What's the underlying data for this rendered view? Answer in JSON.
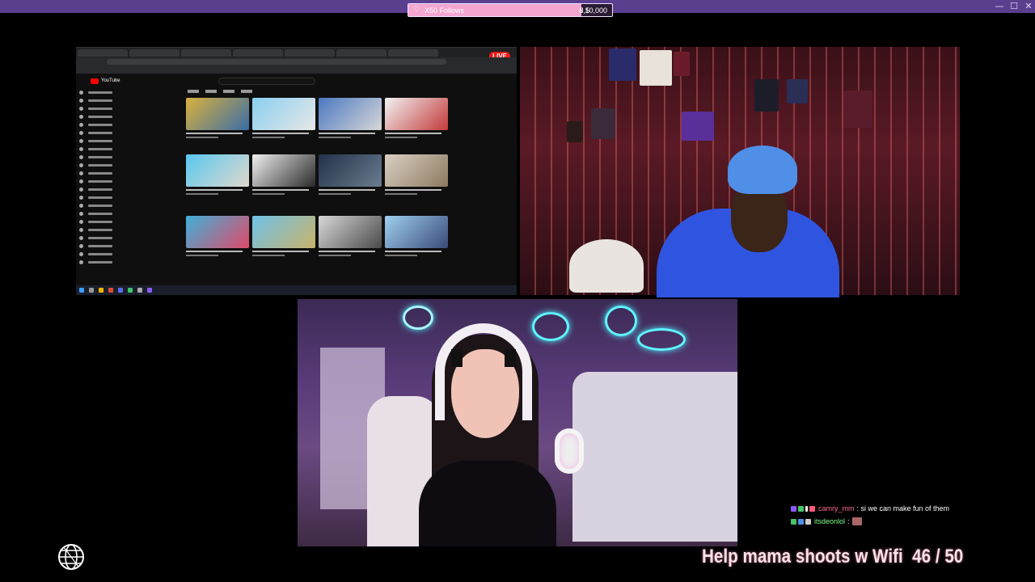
{
  "window": {
    "controls": {
      "minimize": "—",
      "maximize": "☐",
      "close": "✕"
    }
  },
  "follow_goal": {
    "label": "X50 Follows",
    "current": "8,5",
    "target": "/ 10,000",
    "progress_fraction": 0.85,
    "fill_color": "#f4a6d1"
  },
  "screen_share": {
    "live_badge": "LIVE",
    "site": "YouTube",
    "accent": "#ff0000"
  },
  "chat": {
    "messages": [
      {
        "user": "camry_mm",
        "user_color": "#ff6f8a",
        "text": ": si we can make fun of them",
        "badges": [
          "#8a5cff",
          "#46c46a",
          "#ffffff",
          "#ff5c7c"
        ]
      },
      {
        "user": "itsdeonlol",
        "user_color": "#7fff8a",
        "text": " :",
        "badges": [
          "#46c46a",
          "#4f8fe8",
          "#cccccc"
        ],
        "emote": "emote"
      }
    ]
  },
  "stream_goal_text": {
    "title": "Help mama shoots w Wifi",
    "progress": "46 / 50",
    "color": "#ffe1ea"
  },
  "icons": {
    "globe": "globe-icon"
  }
}
